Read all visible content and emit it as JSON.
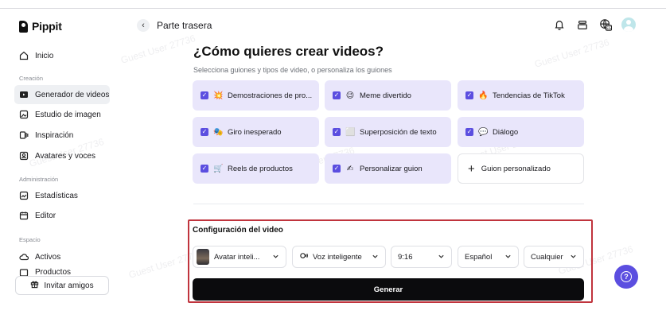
{
  "header": {
    "logo_text": "Pippit",
    "back_label": "Parte trasera",
    "back_icon": "chevron-left-icon",
    "icons": [
      "bell-icon",
      "inbox-icon",
      "language-es-icon",
      "user-avatar"
    ]
  },
  "sidebar": {
    "items_top": [
      {
        "label": "Inicio",
        "icon": "home-icon"
      }
    ],
    "sections": [
      {
        "label": "Creación",
        "items": [
          {
            "label": "Generador de videos",
            "icon": "video-generator-icon",
            "active": true
          },
          {
            "label": "Estudio de imagen",
            "icon": "image-studio-icon"
          },
          {
            "label": "Inspiración",
            "icon": "inspiration-icon"
          },
          {
            "label": "Avatares y voces",
            "icon": "avatar-voice-icon"
          }
        ]
      },
      {
        "label": "Administración",
        "items": [
          {
            "label": "Estadísticas",
            "icon": "stats-icon"
          },
          {
            "label": "Editor",
            "icon": "calendar-icon"
          }
        ]
      },
      {
        "label": "Espacio",
        "items": [
          {
            "label": "Activos",
            "icon": "cloud-icon"
          },
          {
            "label": "Productos",
            "icon": "products-icon"
          }
        ]
      }
    ],
    "invite_label": "Invitar amigos"
  },
  "main": {
    "title": "¿Cómo quieres crear videos?",
    "subtitle": "Selecciona guiones y tipos de video, o personaliza los guiones",
    "cards": [
      {
        "label": "Demostraciones de pro...",
        "emoji": "💥",
        "checked": true
      },
      {
        "label": "Meme divertido",
        "emoji": "😉",
        "checked": true
      },
      {
        "label": "Tendencias de TikTok",
        "emoji": "🔥",
        "checked": true
      },
      {
        "label": "Giro inesperado",
        "emoji": "🎭",
        "checked": true
      },
      {
        "label": "Superposición de texto",
        "emoji": "⬜",
        "checked": true
      },
      {
        "label": "Diálogo",
        "emoji": "💬",
        "checked": true
      },
      {
        "label": "Reels de productos",
        "emoji": "🛒",
        "checked": true
      },
      {
        "label": "Personalizar guion",
        "emoji": "✍",
        "checked": true
      },
      {
        "label": "Guion personalizado",
        "emoji": "+",
        "checked": false
      }
    ]
  },
  "config": {
    "title": "Configuración del video",
    "avatar_label": "Avatar inteli...",
    "voice_label": "Voz inteligente",
    "ratio_label": "9:16",
    "language_label": "Español",
    "duration_label": "Cualquier d",
    "generate_label": "Generar"
  },
  "watermark": "Guest User 27736",
  "colors": {
    "accent": "#5b4ee0",
    "card_bg": "#e9e6fb",
    "highlight_border": "#c0343d",
    "button_bg": "#0b0b0d"
  }
}
